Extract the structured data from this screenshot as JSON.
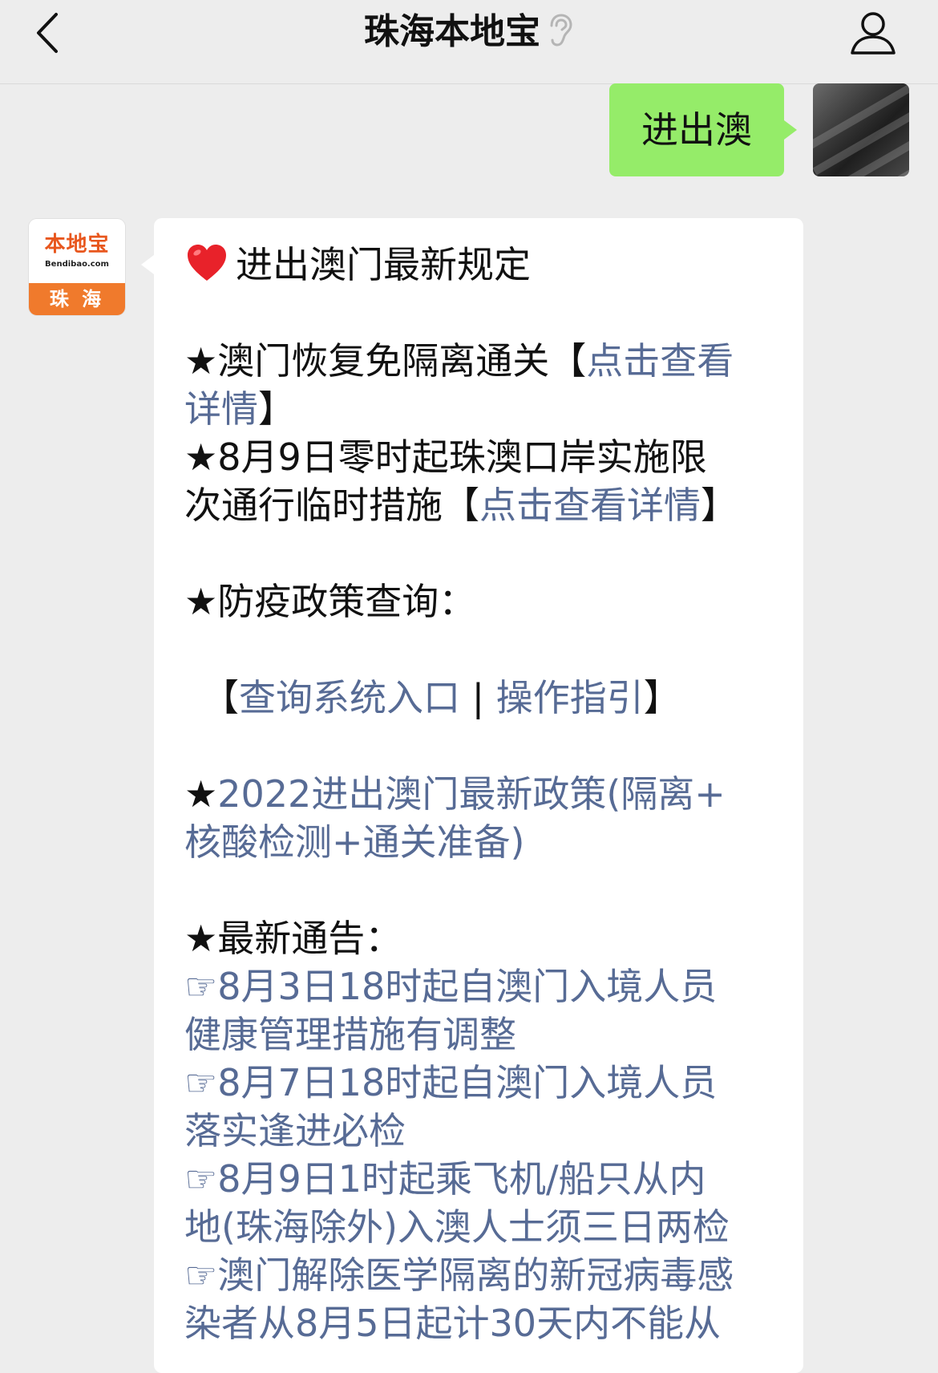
{
  "header": {
    "title": "珠海本地宝"
  },
  "sent_message": {
    "text": "进出澳"
  },
  "account_logo": {
    "cn": "本地宝",
    "en": "Bendibao.com",
    "city": "珠 海"
  },
  "reply": {
    "heading": "进出澳门最新规定",
    "item1_prefix": "★澳门恢复免隔离通关【",
    "item1_link_a": "点击查看",
    "item1_link_b": "详情",
    "item1_suffix": "】",
    "item2_line1": "★8月9日零时起珠澳口岸实施限",
    "item2_line2_prefix": "次通行临时措施【",
    "item2_link": "点击查看详情",
    "item2_suffix": "】",
    "policy_heading": "★防疫政策查询：",
    "query_open": "【",
    "query_link1": "查询系统入口",
    "query_sep": " | ",
    "query_link2": "操作指引",
    "query_close": "】",
    "policy2022_star": "★",
    "policy2022_line1": "2022进出澳门最新政策(隔离+",
    "policy2022_line2": "核酸检测+通关准备)",
    "notice_heading": "★最新通告：",
    "notices": [
      {
        "line1": "☞8月3日18时起自澳门入境人员",
        "line2": "健康管理措施有调整"
      },
      {
        "line1": "☞8月7日18时起自澳门入境人员",
        "line2": "落实逢进必检"
      },
      {
        "line1": "☞8月9日1时起乘飞机/船只从内",
        "line2": "地(珠海除外)入澳人士须三日两检"
      },
      {
        "line1": "☞澳门解除医学隔离的新冠病毒感",
        "line2": "染者从8月5日起计30天内不能从"
      }
    ]
  }
}
